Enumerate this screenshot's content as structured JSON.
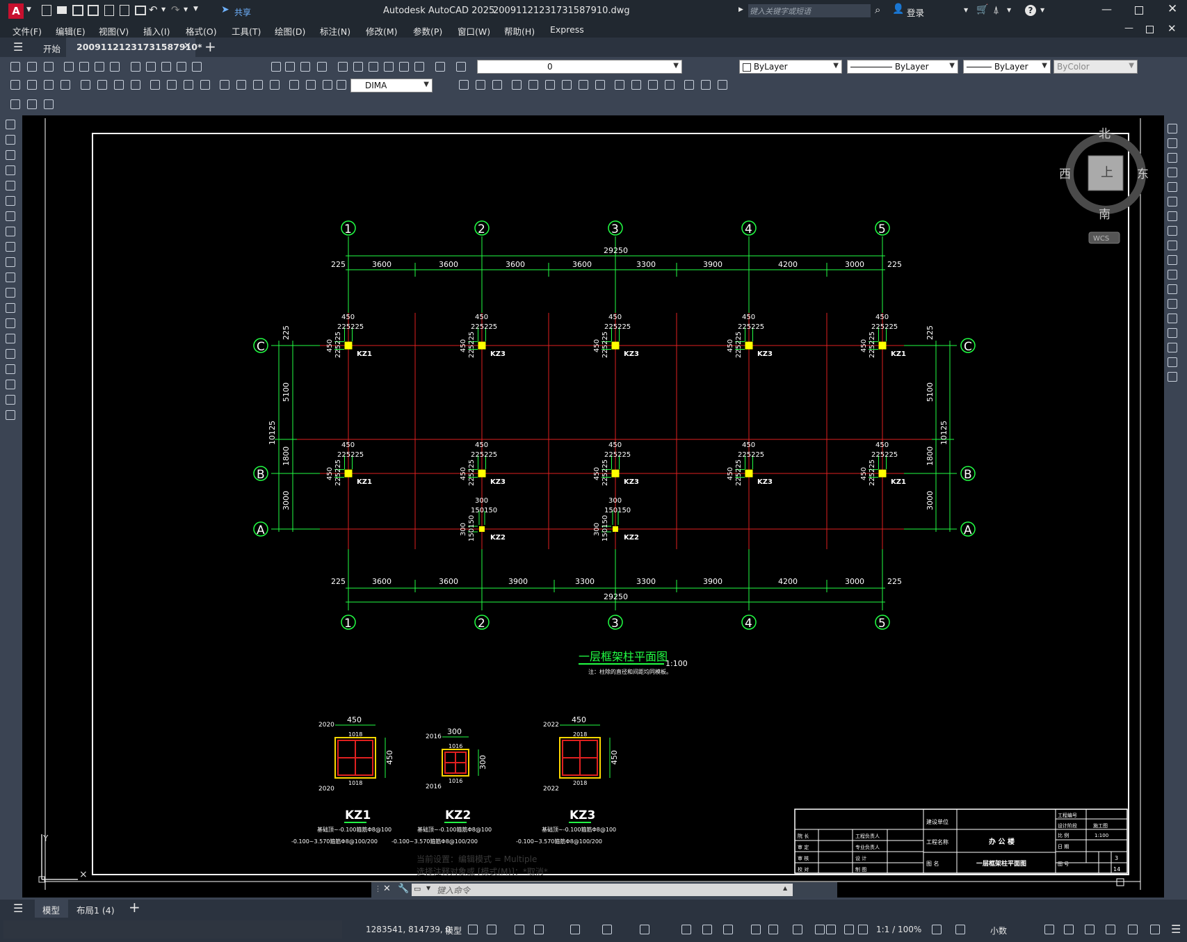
{
  "app": {
    "title": "Autodesk AutoCAD 2025",
    "filename": "20091121231731587910.dwg",
    "search_placeholder": "键入关键字或短语",
    "share": "共享",
    "login": "登录"
  },
  "menu": [
    "文件(F)",
    "编辑(E)",
    "视图(V)",
    "插入(I)",
    "格式(O)",
    "工具(T)",
    "绘图(D)",
    "标注(N)",
    "修改(M)",
    "参数(P)",
    "窗口(W)",
    "帮助(H)",
    "Express"
  ],
  "tabs": {
    "start": "开始",
    "active": "20091121231731587910*"
  },
  "toolbar": {
    "layer_value": "0",
    "color_value": "ByLayer",
    "linetype_value": "ByLayer",
    "lineweight_value": "ByLayer",
    "plotstyle_value": "ByColor",
    "dimstyle_value": "DIMA"
  },
  "viewcube": {
    "north": "北",
    "south": "南",
    "east": "东",
    "west": "西",
    "top": "上",
    "wcs": "WCS"
  },
  "drawing": {
    "grid_numbers": [
      "1",
      "2",
      "3",
      "4",
      "5"
    ],
    "grid_letters": [
      "C",
      "B",
      "A"
    ],
    "total_dim": "29250",
    "edge_dim": "225",
    "top_dims": [
      "3600",
      "3600",
      "3600",
      "3600",
      "3300",
      "3900",
      "4200",
      "3000"
    ],
    "bottom_dims": [
      "3600",
      "3600",
      "3900",
      "3300",
      "3300",
      "3900",
      "4200",
      "3000"
    ],
    "left_dims": [
      "5100",
      "1800",
      "3000"
    ],
    "left_total": "10125",
    "col_dim": "450",
    "col_half": "225225",
    "col_dim2": "300",
    "col_half2": "150150",
    "col_labels": {
      "kz1": "KZ1",
      "kz2": "KZ2",
      "kz3": "KZ3"
    },
    "title": "一层框架柱平面图",
    "scale": "1:100",
    "note": "注：柱除的直径和间距均同模板。",
    "sections": [
      {
        "name": "KZ1",
        "dim": "450",
        "rebar_corner": "2020",
        "rebar_side": "1018",
        "line1": "基础顶~-0.100箍筋Φ8@100",
        "line2": "-0.100~3.570箍筋Φ8@100/200"
      },
      {
        "name": "KZ2",
        "dim": "300",
        "rebar_corner": "2016",
        "rebar_side": "1016",
        "line1": "基础顶~-0.100箍筋Φ8@100",
        "line2": "-0.100~3.570箍筋Φ8@100/200"
      },
      {
        "name": "KZ3",
        "dim": "450",
        "rebar_corner": "2022",
        "rebar_side": "2018",
        "line1": "基础顶~-0.100箍筋Φ8@100",
        "line2": "-0.100~3.570箍筋Φ8@100/200"
      }
    ],
    "titleblock": {
      "owner": "建设单位",
      "project_label": "工程名称",
      "project": "办 公 楼",
      "drawing_label": "图 名",
      "drawing_name": "一层框架柱平面图",
      "no": "工程编号",
      "phase": "设计阶段",
      "phase_val": "施工图",
      "scale": "比 例",
      "scale_val": "1:100",
      "date": "日 期",
      "sheet": "图 号",
      "rows": [
        "院 长",
        "审 定",
        "审 核",
        "校 对"
      ],
      "rows2": [
        "工程负责人",
        "专业负责人",
        "设 计",
        "制 图"
      ],
      "total": "3",
      "page": "14"
    }
  },
  "command": {
    "history1": "当前设置：编辑模式 = Multiple",
    "history2": "选择注释对象或 [模式(M)]：*取消*",
    "placeholder": "键入命令"
  },
  "layout_tabs": [
    "模型",
    "布局1 (4)"
  ],
  "status": {
    "coords": "1283541, 814739, 0",
    "model": "模型",
    "scale": "1:1 / 100%",
    "units": "小数"
  }
}
